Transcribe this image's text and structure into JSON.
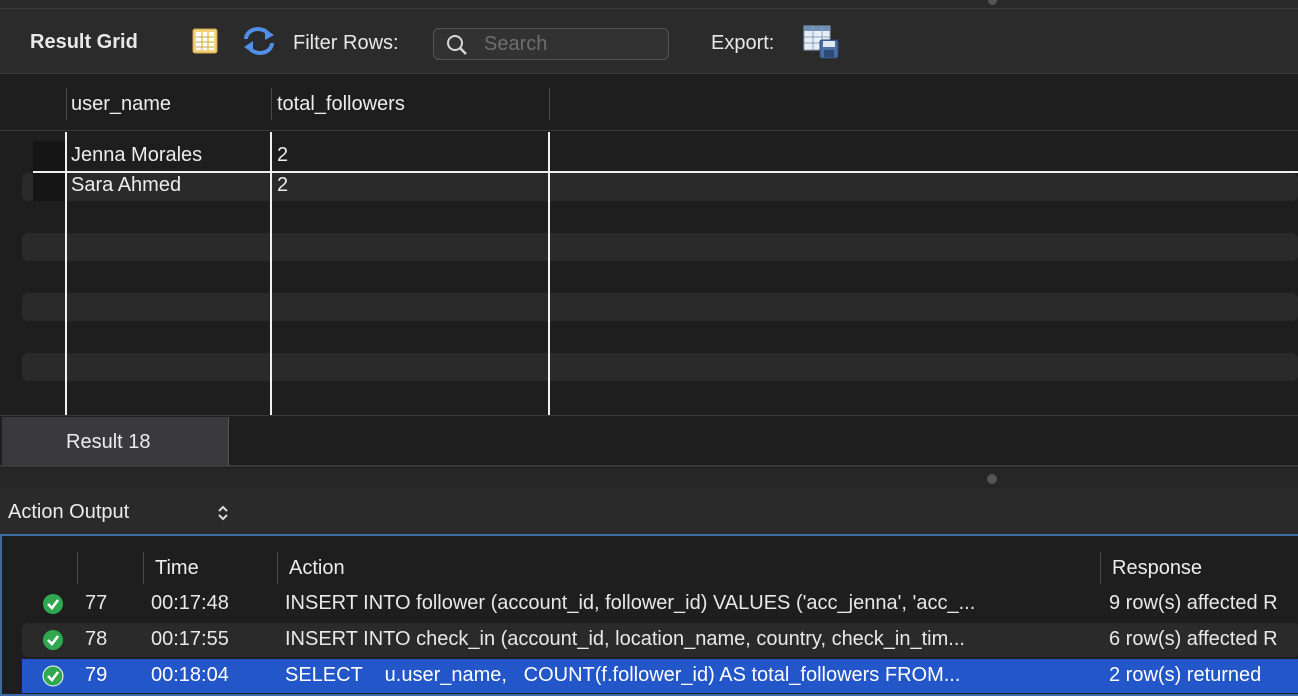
{
  "toolbar": {
    "title": "Result Grid",
    "filter_label": "Filter Rows:",
    "search_placeholder": "Search",
    "export_label": "Export:"
  },
  "grid": {
    "columns": [
      "user_name",
      "total_followers"
    ],
    "rows": [
      [
        "Jenna Morales",
        "2"
      ],
      [
        "Sara Ahmed",
        "2"
      ]
    ]
  },
  "tabs": {
    "result_tab": "Result 18"
  },
  "output": {
    "selector_label": "Action Output",
    "columns": {
      "time": "Time",
      "action": "Action",
      "response": "Response"
    },
    "rows": [
      {
        "status": "ok",
        "num": "77",
        "time": "00:17:48",
        "action": "INSERT INTO follower (account_id, follower_id) VALUES ('acc_jenna', 'acc_...",
        "response": "9 row(s) affected R"
      },
      {
        "status": "ok",
        "num": "78",
        "time": "00:17:55",
        "action": "INSERT INTO check_in (account_id, location_name, country, check_in_tim...",
        "response": "6 row(s) affected R"
      },
      {
        "status": "ok",
        "num": "79",
        "time": "00:18:04",
        "action": "SELECT    u.user_name,   COUNT(f.follower_id) AS total_followers FROM...",
        "response": "2 row(s) returned"
      }
    ]
  },
  "colors": {
    "selection": "#2356c9",
    "panel_border": "#3c6aa3",
    "ok_green": "#2fa84f"
  },
  "icons": {
    "form_editor": "form-columns-icon",
    "refresh": "refresh-arrows-icon",
    "search": "search-icon",
    "export": "export-grid-icon",
    "selector": "up-down-chevron-icon",
    "status": "check-circle-icon"
  }
}
